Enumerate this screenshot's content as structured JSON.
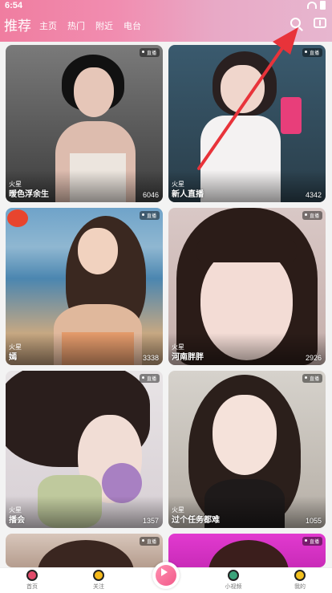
{
  "status": {
    "time": "6:54"
  },
  "tabs": [
    {
      "label": "推荐",
      "active": true
    },
    {
      "label": "主页"
    },
    {
      "label": "热门"
    },
    {
      "label": "附近"
    },
    {
      "label": "电台"
    }
  ],
  "header_icons": [
    "search-icon",
    "message-icon"
  ],
  "cards": [
    {
      "badge": "直播",
      "tag": "火星",
      "name": "暧色浮余生",
      "count": "6046"
    },
    {
      "badge": "直播",
      "tag": "火星",
      "name": "新人直播",
      "count": "4342"
    },
    {
      "badge": "直播",
      "tag": "火星",
      "name": "嫣",
      "count": "3338"
    },
    {
      "badge": "直播",
      "tag": "火星",
      "name": "河南胖胖",
      "count": "2926"
    },
    {
      "badge": "直播",
      "tag": "火星",
      "name": "播会",
      "count": "1357"
    },
    {
      "badge": "直播",
      "tag": "火星",
      "name": "过个任务都难",
      "count": "1055"
    },
    {
      "badge": "直播"
    },
    {
      "badge": "直播"
    }
  ],
  "bottom_nav": [
    {
      "label": "首页",
      "icon": "home-icon"
    },
    {
      "label": "关注",
      "icon": "follow-icon"
    },
    {
      "label": "",
      "icon": "live-play-icon"
    },
    {
      "label": "小视频",
      "icon": "video-icon"
    },
    {
      "label": "我的",
      "icon": "profile-icon"
    }
  ],
  "colors": {
    "accent": "#f07da0",
    "arrow": "#e8333a"
  }
}
